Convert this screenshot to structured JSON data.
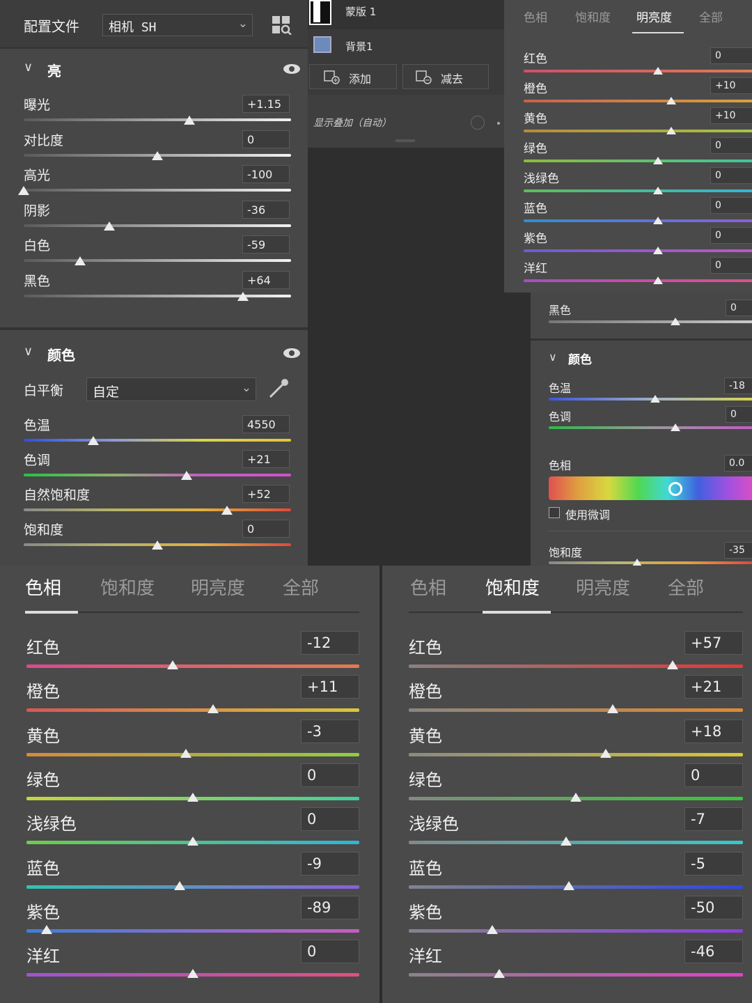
{
  "panel_a": {
    "profile_label": "配置文件",
    "profile_value": "相机 SH",
    "light": {
      "title": "亮",
      "sliders": [
        {
          "label": "曝光",
          "value": "+1.15",
          "pos": 0.62
        },
        {
          "label": "对比度",
          "value": "0",
          "pos": 0.5
        },
        {
          "label": "高光",
          "value": "-100",
          "pos": 0.0
        },
        {
          "label": "阴影",
          "value": "-36",
          "pos": 0.32
        },
        {
          "label": "白色",
          "value": "-59",
          "pos": 0.21
        },
        {
          "label": "黑色",
          "value": "+64",
          "pos": 0.82
        }
      ]
    },
    "color": {
      "title": "颜色",
      "wb_label": "白平衡",
      "wb_value": "自定",
      "sliders": [
        {
          "label": "色温",
          "value": "4550",
          "pos": 0.26,
          "gradient": "temp"
        },
        {
          "label": "色调",
          "value": "+21",
          "pos": 0.61,
          "gradient": "tint"
        },
        {
          "label": "自然饱和度",
          "value": "+52",
          "pos": 0.76,
          "gradient": "sat"
        },
        {
          "label": "饱和度",
          "value": "0",
          "pos": 0.5,
          "gradient": "sat"
        }
      ]
    }
  },
  "panel_b": {
    "layers": [
      {
        "name": "蒙版 1",
        "thumb": "mask"
      },
      {
        "name": "背景1",
        "thumb": "image"
      }
    ],
    "add_label": "添加",
    "subtract_label": "减去",
    "overlay_label": "显示叠加（自动）"
  },
  "panel_c": {
    "tabs": [
      "色相",
      "饱和度",
      "明亮度",
      "全部"
    ],
    "active_tab": 2,
    "rows": [
      {
        "label": "红色",
        "value": "0",
        "pos": 0.5,
        "c1": "#d14f6a",
        "c2": "#e07a55"
      },
      {
        "label": "橙色",
        "value": "+10",
        "pos": 0.55,
        "c1": "#c9604f",
        "c2": "#d8a23b"
      },
      {
        "label": "黄色",
        "value": "+10",
        "pos": 0.55,
        "c1": "#b88a3c",
        "c2": "#a7c444"
      },
      {
        "label": "绿色",
        "value": "0",
        "pos": 0.5,
        "c1": "#8fbb3c",
        "c2": "#3fc49c"
      },
      {
        "label": "浅绿色",
        "value": "0",
        "pos": 0.5,
        "c1": "#5fbd5a",
        "c2": "#32b6d6"
      },
      {
        "label": "蓝色",
        "value": "0",
        "pos": 0.5,
        "c1": "#2f8fd0",
        "c2": "#8c5ed8"
      },
      {
        "label": "紫色",
        "value": "0",
        "pos": 0.5,
        "c1": "#6a5dd0",
        "c2": "#c255c9"
      },
      {
        "label": "洋红",
        "value": "0",
        "pos": 0.5,
        "c1": "#a84ec4",
        "c2": "#e04f8c"
      }
    ]
  },
  "panel_d": {
    "black_label": "黑色",
    "black_value": "0",
    "black_pos": 0.5,
    "color_title": "颜色",
    "temp_label": "色温",
    "temp_value": "-18",
    "temp_pos": 0.41,
    "tint_label": "色调",
    "tint_value": "0",
    "tint_pos": 0.5,
    "hue_label": "色相",
    "hue_value": "0.0",
    "hue_pos": 0.5,
    "fine_label": "使用微调",
    "sat_label": "饱和度",
    "sat_value": "-35",
    "sat_pos": 0.33
  },
  "panel_e": {
    "tabs": [
      "色相",
      "饱和度",
      "明亮度",
      "全部"
    ],
    "active_tab": 0,
    "rows": [
      {
        "label": "红色",
        "value": "-12",
        "pos": 0.44,
        "c1": "#d64c8f",
        "c2": "#e27b4e"
      },
      {
        "label": "橙色",
        "value": "+11",
        "pos": 0.56,
        "c1": "#d85656",
        "c2": "#d8c83a"
      },
      {
        "label": "黄色",
        "value": "-3",
        "pos": 0.48,
        "c1": "#d8893a",
        "c2": "#8fcf3f"
      },
      {
        "label": "绿色",
        "value": "0",
        "pos": 0.5,
        "c1": "#c8d43c",
        "c2": "#3fcf9a"
      },
      {
        "label": "浅绿色",
        "value": "0",
        "pos": 0.5,
        "c1": "#6ccd48",
        "c2": "#2fb6d8"
      },
      {
        "label": "蓝色",
        "value": "-9",
        "pos": 0.46,
        "c1": "#34c2b0",
        "c2": "#8c5ed8"
      },
      {
        "label": "紫色",
        "value": "-89",
        "pos": 0.06,
        "c1": "#3f7fd6",
        "c2": "#c95bc4"
      },
      {
        "label": "洋红",
        "value": "0",
        "pos": 0.5,
        "c1": "#9e54d2",
        "c2": "#e0507e"
      }
    ]
  },
  "panel_f": {
    "tabs": [
      "色相",
      "饱和度",
      "明亮度",
      "全部"
    ],
    "active_tab": 1,
    "rows": [
      {
        "label": "红色",
        "value": "+57",
        "pos": 0.79,
        "c1": "#8a8080",
        "c2": "#e03a3a"
      },
      {
        "label": "橙色",
        "value": "+21",
        "pos": 0.61,
        "c1": "#8a8580",
        "c2": "#e08a32"
      },
      {
        "label": "黄色",
        "value": "+18",
        "pos": 0.59,
        "c1": "#8a8a80",
        "c2": "#d8c830"
      },
      {
        "label": "绿色",
        "value": "0",
        "pos": 0.5,
        "c1": "#828a82",
        "c2": "#38c838"
      },
      {
        "label": "浅绿色",
        "value": "-7",
        "pos": 0.47,
        "c1": "#828a8a",
        "c2": "#36c8c8"
      },
      {
        "label": "蓝色",
        "value": "-5",
        "pos": 0.48,
        "c1": "#80848c",
        "c2": "#3048e0"
      },
      {
        "label": "紫色",
        "value": "-50",
        "pos": 0.25,
        "c1": "#86828c",
        "c2": "#8a3ee0"
      },
      {
        "label": "洋红",
        "value": "-46",
        "pos": 0.27,
        "c1": "#8a828a",
        "c2": "#e040c8"
      }
    ]
  }
}
